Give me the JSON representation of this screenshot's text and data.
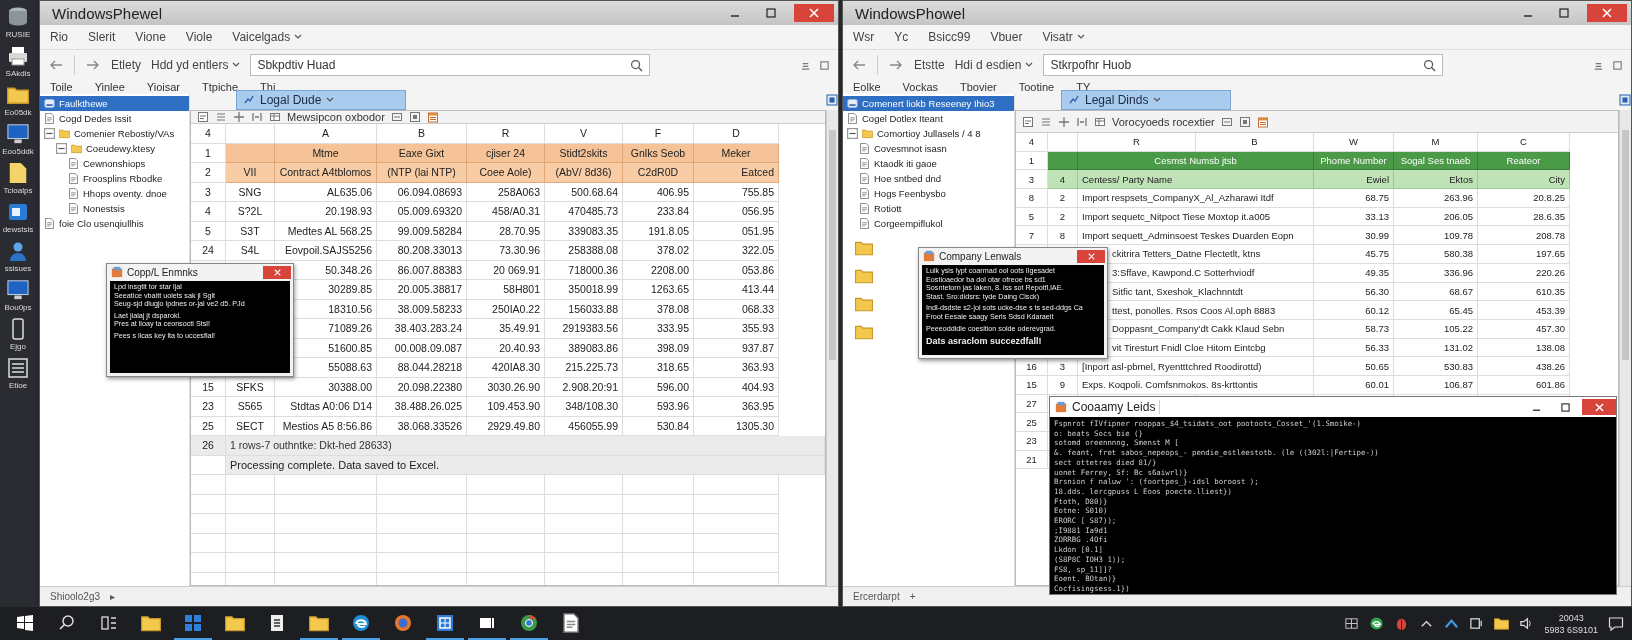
{
  "desktop_icons": [
    {
      "label": "RUSIE",
      "kind": "disk"
    },
    {
      "label": "SAkdis",
      "kind": "printer"
    },
    {
      "label": "Eo05dk",
      "kind": "folder"
    },
    {
      "label": "Eoo5ddk",
      "kind": "monitor"
    },
    {
      "label": "Tcioalps",
      "kind": "file"
    },
    {
      "label": "dewstsis",
      "kind": "app"
    },
    {
      "label": "ssisues",
      "kind": "user"
    },
    {
      "label": "Bou0ps",
      "kind": "monitor"
    },
    {
      "label": "Ejgo",
      "kind": "phone"
    },
    {
      "label": "Etioe",
      "kind": "list"
    }
  ],
  "windows": [
    {
      "title": "WindowsPhewel",
      "menu": [
        "Rio",
        "Slerit",
        "Vione",
        "Viole",
        "Vaicelgads"
      ],
      "nav": [
        "Etlety",
        "Hdd yd entlers"
      ],
      "search": {
        "value": "Sbkpdtiv Huad"
      },
      "ribbon": [
        "Toile",
        "Yinlee",
        "Yioisar",
        "Ttpiche",
        "Thi"
      ],
      "tree": [
        {
          "label": "Faulkthewe",
          "kind": "drive",
          "selected": true
        },
        {
          "label": "Cogd Dedes Issit",
          "kind": "doc",
          "selected": false
        },
        {
          "label": "Comenier Rebostiy/VAs",
          "kind": "folder",
          "selected": false,
          "children": [
            {
              "label": "Coeudewy.ktesy",
              "kind": "folder",
              "selected": false,
              "children": [
                {
                  "label": "Cewnonshiops",
                  "kind": "doc",
                  "selected": false
                },
                {
                  "label": "Froosplins Rbodke",
                  "kind": "doc",
                  "selected": false
                },
                {
                  "label": "Hhops oventy. dnoe",
                  "kind": "doc",
                  "selected": false
                },
                {
                  "label": "Nonestsis",
                  "kind": "doc",
                  "selected": false
                }
              ]
            }
          ]
        },
        {
          "label": "foie Clo usenqiullhis",
          "kind": "doc",
          "selected": false
        }
      ],
      "sheet": {
        "kind": "orange",
        "tab": "Logal Dude",
        "toolbar_label": "Mewsipcon oxbodor",
        "corner": "4",
        "column_letters": [
          "A",
          "B",
          "R",
          "V",
          "F",
          "D"
        ],
        "rows": [
          {
            "kind": "head",
            "number": "1",
            "cells": [
              "Mtme",
              "Eaxe Gixt",
              "cjiser 24",
              "Stidt2skits",
              "Gnlks Seob",
              "Meker"
            ]
          },
          {
            "kind": "subhead",
            "number": "2",
            "key": "VII",
            "cells": [
              "Contract A4tblomos",
              "(NTP (lai NTP)",
              "Coee Aole)",
              "(AbV/ 8d36)",
              "C2dR0D",
              "Eatced"
            ]
          },
          {
            "kind": "data",
            "number": "3",
            "key": "SNG",
            "cells": [
              "AL635.06",
              "06.094.08693",
              "258A063",
              "500.68.64",
              "406.95",
              "755.85"
            ]
          },
          {
            "kind": "data",
            "number": "4",
            "key": "S?2L",
            "cells": [
              "20.198.93",
              "05.009.69320",
              "458/A0.31",
              "470485.73",
              "233.84",
              "056.95"
            ]
          },
          {
            "kind": "data",
            "number": "5",
            "key": "S3T",
            "cells": [
              "Medtes AL 568.25",
              "99.009.58284",
              "28.70.95",
              "339083.35",
              "191.8.05",
              "051.95"
            ]
          },
          {
            "kind": "data",
            "number": "24",
            "key": "S4L",
            "cells": [
              "Eovpoil.SAJS5256",
              "80.208.33013",
              "73.30.96",
              "258388.08",
              "378.02",
              "322.05"
            ]
          },
          {
            "kind": "data",
            "cells": [
              "50.348.26",
              "86.007.88383",
              "20 069.91",
              "718000.36",
              "2208.00",
              "053.86"
            ]
          },
          {
            "kind": "data",
            "cells": [
              "30289.85",
              "20.005.38817",
              "58H801",
              "350018.99",
              "1263.65",
              "413.44"
            ]
          },
          {
            "kind": "data",
            "cells": [
              "18310.56",
              "38.009.58233",
              "250IA0.22",
              "156033.88",
              "378.08",
              "068.33"
            ]
          },
          {
            "kind": "data",
            "cells": [
              "71089.26",
              "38.403.283.24",
              "35.49.91",
              "2919383.56",
              "333.95",
              "355.93"
            ]
          },
          {
            "kind": "data",
            "cells": [
              "51600.85",
              "00.008.09.087",
              "20.40.93",
              "389083.86",
              "398.09",
              "937.87"
            ]
          },
          {
            "kind": "data",
            "cells": [
              "55088.63",
              "88.044.28218",
              "420IA8.30",
              "215.225.73",
              "318.65",
              "363.93"
            ]
          },
          {
            "kind": "data",
            "number": "15",
            "key": "SFKS",
            "cells": [
              "30388.00",
              "20.098.22380",
              "3030.26.90",
              "2.908.20:91",
              "596.00",
              "404.93"
            ]
          },
          {
            "kind": "data",
            "number": "23",
            "key": "S565",
            "cells": [
              "Stdtas A0:06 D14",
              "38.488.26.025",
              "109.453.90",
              "348/108.30",
              "593.96",
              "363.95"
            ]
          },
          {
            "kind": "data",
            "number": "25",
            "key": "SECT",
            "cells": [
              "Mestios A5 8:56.86",
              "38.068.33526",
              "2929.49.80",
              "456055.99",
              "530.84",
              "1305.30"
            ]
          }
        ],
        "summary": {
          "number": "26",
          "text": "1 rows-7 outhntke: Dkt-hed 28633)"
        },
        "message": "Processing complete. Data saved to Excel."
      },
      "status": {
        "sheet": "Shioolo2g3",
        "nav": "▸"
      },
      "dialog": {
        "title": "Copp/L Enmnks",
        "paragraphs": [
          {
            "bold": false,
            "lines": [
              "Lpd insgtit tor star ljal",
              "Seeatice vbaitt uoiets sak jl Sglt",
              "Seug-sjd dlugjo lpdnes or-jal ve2 d5. PJd"
            ]
          },
          {
            "bold": false,
            "lines": [
              "Laet jlalaj jt dsparokl.",
              "Pres at lloay ta ceonsoctl Stsl!"
            ]
          },
          {
            "bold": false,
            "lines": [
              "Pees s ilcas key lta to uccesfial!"
            ]
          }
        ]
      }
    },
    {
      "title": "WindowsPhowel",
      "menu": [
        "Wsr",
        "Yc",
        "Bsicc99",
        "Vbuer",
        "Visatr"
      ],
      "nav": [
        "Etstte",
        "Hdi d esdien"
      ],
      "search": {
        "value": "Stkrpofhr Huob"
      },
      "ribbon": [
        "Eolke",
        "Vockas",
        "Tbovier",
        "Tootine",
        "TY"
      ],
      "tree": [
        {
          "label": "Comenert liokb Reseeney Ihio3",
          "kind": "drive",
          "selected": true
        },
        {
          "label": "Cogel Dotlex Iteant",
          "kind": "doc",
          "selected": false
        },
        {
          "label": "Comortioy Jullasels / 4 8",
          "kind": "folder",
          "selected": false,
          "children": [
            {
              "label": "Covesmnot isasn",
              "kind": "doc",
              "selected": false
            },
            {
              "label": "Ktaodk iti gaoe",
              "kind": "doc",
              "selected": false
            },
            {
              "label": "Hoe sntbed dnd",
              "kind": "doc",
              "selected": false
            },
            {
              "label": "Hogs Feenbysbo",
              "kind": "doc",
              "selected": false
            },
            {
              "label": "Rotiott",
              "kind": "doc",
              "selected": false
            },
            {
              "label": "Corgeempiflukol",
              "kind": "doc",
              "selected": false
            }
          ]
        }
      ],
      "sheet": {
        "kind": "green",
        "tab": "Legal Dinds",
        "toolbar_label": "Vorocyoeds rocextier",
        "corner": "4",
        "column_letters": [
          "R",
          "B",
          "W",
          "M",
          "C"
        ],
        "rows": [
          {
            "kind": "head",
            "number": "1",
            "cells": [
              "Cesmst Numsb jtsb",
              "Phome Number",
              "Sogal Ses tnaeb",
              "Reateor"
            ]
          },
          {
            "kind": "subhead",
            "number": "3",
            "key": "4",
            "cells": [
              "Centess/ Party Name",
              "Ewiel",
              "Ektos",
              "City"
            ]
          },
          {
            "kind": "data",
            "number": "8",
            "key": "2",
            "cells": [
              "Import respsets_CompanyX_Al_Azharawi Itdf",
              "68.75",
              "263.96",
              "20.8.25"
            ]
          },
          {
            "kind": "data",
            "number": "5",
            "key": "2",
            "cells": [
              "Import sequetc_Nitpoct Tiese Moxtop it.a005",
              "33.13",
              "206.05",
              "28.6.35"
            ]
          },
          {
            "kind": "data",
            "number": "7",
            "key": "8",
            "cells": [
              "Import sequett_Adminsoest Teskes Duarden Eopn",
              "30.99",
              "109.78",
              "208.78"
            ]
          },
          {
            "kind": "data",
            "cells": [
              "ckitrira Tetters_Datne Flectetlt, ktns",
              "45.75",
              "580.38",
              "197.65"
            ]
          },
          {
            "kind": "data",
            "cells": [
              "3:Sffave, Kawpond.C Sotterhviodf",
              "49.35",
              "336.96",
              "220.26"
            ]
          },
          {
            "kind": "data",
            "cells": [
              "Sitfic tant, Sxeshok_Klachnntdt",
              "56.30",
              "68.67",
              "610.35"
            ]
          },
          {
            "kind": "data",
            "cells": [
              "ttest, ponolles. Rsos Coos Al.oph 8883",
              "60.12",
              "65.45",
              "453.39"
            ]
          },
          {
            "kind": "data",
            "cells": [
              "Doppasnt_Company'dt Cakk Klaud Sebn",
              "58.73",
              "105.22",
              "457.30"
            ]
          },
          {
            "kind": "data",
            "cells": [
              "vit Tiresturt Fnidl Cloe Hitom Eintcbg",
              "56.33",
              "131.02",
              "138.08"
            ]
          },
          {
            "kind": "data",
            "number": "16",
            "key": "3",
            "cells": [
              "[Inport asl-pbmel, Ryentttchred Roodirottd)",
              "50.65",
              "530.83",
              "438.26"
            ]
          },
          {
            "kind": "data",
            "number": "15",
            "key": "9",
            "cells": [
              "Exps. Koqpoli. Comfsnmokos. 8s-krttontis",
              "60.01",
              "106.87",
              "601.86"
            ]
          },
          {
            "kind": "data",
            "number": "27",
            "cells": []
          },
          {
            "kind": "data",
            "number": "25",
            "cells": []
          },
          {
            "kind": "data",
            "number": "23",
            "cells": []
          },
          {
            "kind": "data",
            "number": "21",
            "cells": []
          }
        ]
      },
      "status": {
        "sheet": "Ercerdarpt",
        "nav": "+"
      },
      "dialog": {
        "title": "Company Lenwals",
        "paragraphs": [
          {
            "bold": false,
            "lines": [
              "Lulk ysis lypt coarmad ool oots Ilgesadet",
              "Eostioaedor ba dol otar ofreoe bs sd1",
              "Sosntetorn jas laken, 8. lss sot Repotfl,lAE.",
              "Stast. Sro:didsrs: tyde Daing Clsck)"
            ]
          },
          {
            "bold": false,
            "lines": [
              "Indl-dsdste s2-|ol sots ucke-dse s ts sed-ddgs Ca",
              "Froot Eesaie saagy Seris Sdsd Kdaraeit"
            ]
          },
          {
            "bold": false,
            "lines": [
              "Peeeoddidle coesition solde oderevgrad."
            ]
          },
          {
            "bold": true,
            "lines": [
              "Dats asraclom succezdfall!"
            ]
          }
        ]
      },
      "terminal": {
        "title": "Cooaamy Leids",
        "lines": [
          "Fspnrot fIVfipner rooppas_$4_tsidats_oot pootoots_Cosset_'(1.Smoike-)",
          "o: beats Socs bie (}",
          "sotomd oreennnng, Smenst M [",
          "&. feant, fret sabos_nepeops_- pendie_estleestotb. (le ((302l:|Fertipe-))",
          "sect ottetres died 81/}",
          "uonet Ferrey, Sf: Bc s6aiwrl)}",
          "Brsnion f naluw ': (foortpes_}-idsl boroost );",
          "18.dds. lercgpuss L Eoos poecte.lliest})",
          "Ftoth, D80)}",
          "Eotne: S010)",
          "ERORC [ S87));",
          ";I9881 Ia9d1",
          "ZORRBG .4Ofi",
          "Lkdon [0.1]",
          "(S8P8C IOH3 1));",
          "FS8, sp_11]]?",
          "Eoent. BOtan)}",
          "Cocfisingsess.1})"
        ]
      }
    }
  ],
  "taskbar": {
    "apps": [
      {
        "kind": "folder",
        "running": false
      },
      {
        "kind": "tiles",
        "running": true
      },
      {
        "kind": "folder",
        "running": false
      },
      {
        "kind": "list",
        "running": false
      },
      {
        "kind": "folder",
        "running": true
      },
      {
        "kind": "swirl",
        "running": true
      },
      {
        "kind": "globe",
        "running": false
      },
      {
        "kind": "window",
        "running": true
      },
      {
        "kind": "panel",
        "running": true
      },
      {
        "kind": "ring",
        "running": true
      },
      {
        "kind": "doc",
        "running": false
      }
    ],
    "clock": [
      "20043",
      "5983 6S9101"
    ]
  }
}
